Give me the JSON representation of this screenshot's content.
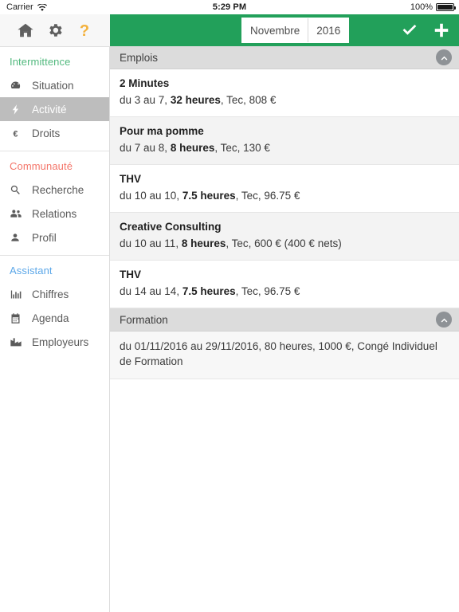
{
  "statusbar": {
    "carrier": "Carrier",
    "wifi_icon": "wifi-icon",
    "time": "5:29 PM",
    "battery_label": "100%",
    "battery_icon": "battery-full-icon"
  },
  "toolbar": {
    "icons": [
      {
        "name": "home-icon",
        "label": "Accueil"
      },
      {
        "name": "gear-icon",
        "label": "Réglages"
      },
      {
        "name": "help-question-icon",
        "label": "Aide"
      }
    ]
  },
  "header": {
    "background_color": "#22a05a",
    "period": {
      "month": "Novembre",
      "year": "2016"
    },
    "actions": [
      {
        "name": "validate-check-icon",
        "label": "Valider"
      },
      {
        "name": "add-plus-icon",
        "label": "Ajouter"
      }
    ]
  },
  "sidebar": {
    "groups": [
      {
        "title": "Intermittence",
        "color": "#52b97e",
        "color_class": "green",
        "items": [
          {
            "label": "Situation",
            "icon": "dashboard-gauge-icon",
            "active": false
          },
          {
            "label": "Activité",
            "icon": "lightning-bolt-icon",
            "active": true
          },
          {
            "label": "Droits",
            "icon": "euro-icon",
            "active": false
          }
        ]
      },
      {
        "title": "Communauté",
        "color": "#f4766a",
        "color_class": "salmon",
        "items": [
          {
            "label": "Recherche",
            "icon": "search-icon",
            "active": false
          },
          {
            "label": "Relations",
            "icon": "users-group-icon",
            "active": false
          },
          {
            "label": "Profil",
            "icon": "user-icon",
            "active": false
          }
        ]
      },
      {
        "title": "Assistant",
        "color": "#5ba7e8",
        "color_class": "blue",
        "items": [
          {
            "label": "Chiffres",
            "icon": "bar-chart-icon",
            "active": false
          },
          {
            "label": "Agenda",
            "icon": "calendar-icon",
            "active": false
          },
          {
            "label": "Employeurs",
            "icon": "factory-icon",
            "active": false
          }
        ]
      }
    ]
  },
  "content": {
    "sections": [
      {
        "title": "Emplois",
        "collapse_icon": "chevron-up-circle-icon",
        "rows": [
          {
            "title": "2 Minutes",
            "dates": "du 3 au 7, ",
            "hours": "32 heures",
            "rest": ", Tec, 808 €"
          },
          {
            "title": "Pour ma pomme",
            "dates": "du 7 au 8, ",
            "hours": "8 heures",
            "rest": ", Tec, 130 €"
          },
          {
            "title": "THV",
            "dates": "du 10 au 10, ",
            "hours": "7.5 heures",
            "rest": ", Tec, 96.75 €"
          },
          {
            "title": "Creative Consulting",
            "dates": "du 10 au 11, ",
            "hours": "8 heures",
            "rest": ", Tec, 600 € (400 € nets)"
          },
          {
            "title": "THV",
            "dates": "du 14 au 14, ",
            "hours": "7.5 heures",
            "rest": ", Tec, 96.75 €"
          }
        ]
      },
      {
        "title": "Formation",
        "collapse_icon": "chevron-up-circle-icon",
        "plain_rows": [
          "du 01/11/2016 au 29/11/2016, 80 heures, 1000 €, Congé Individuel de Formation"
        ]
      }
    ]
  }
}
